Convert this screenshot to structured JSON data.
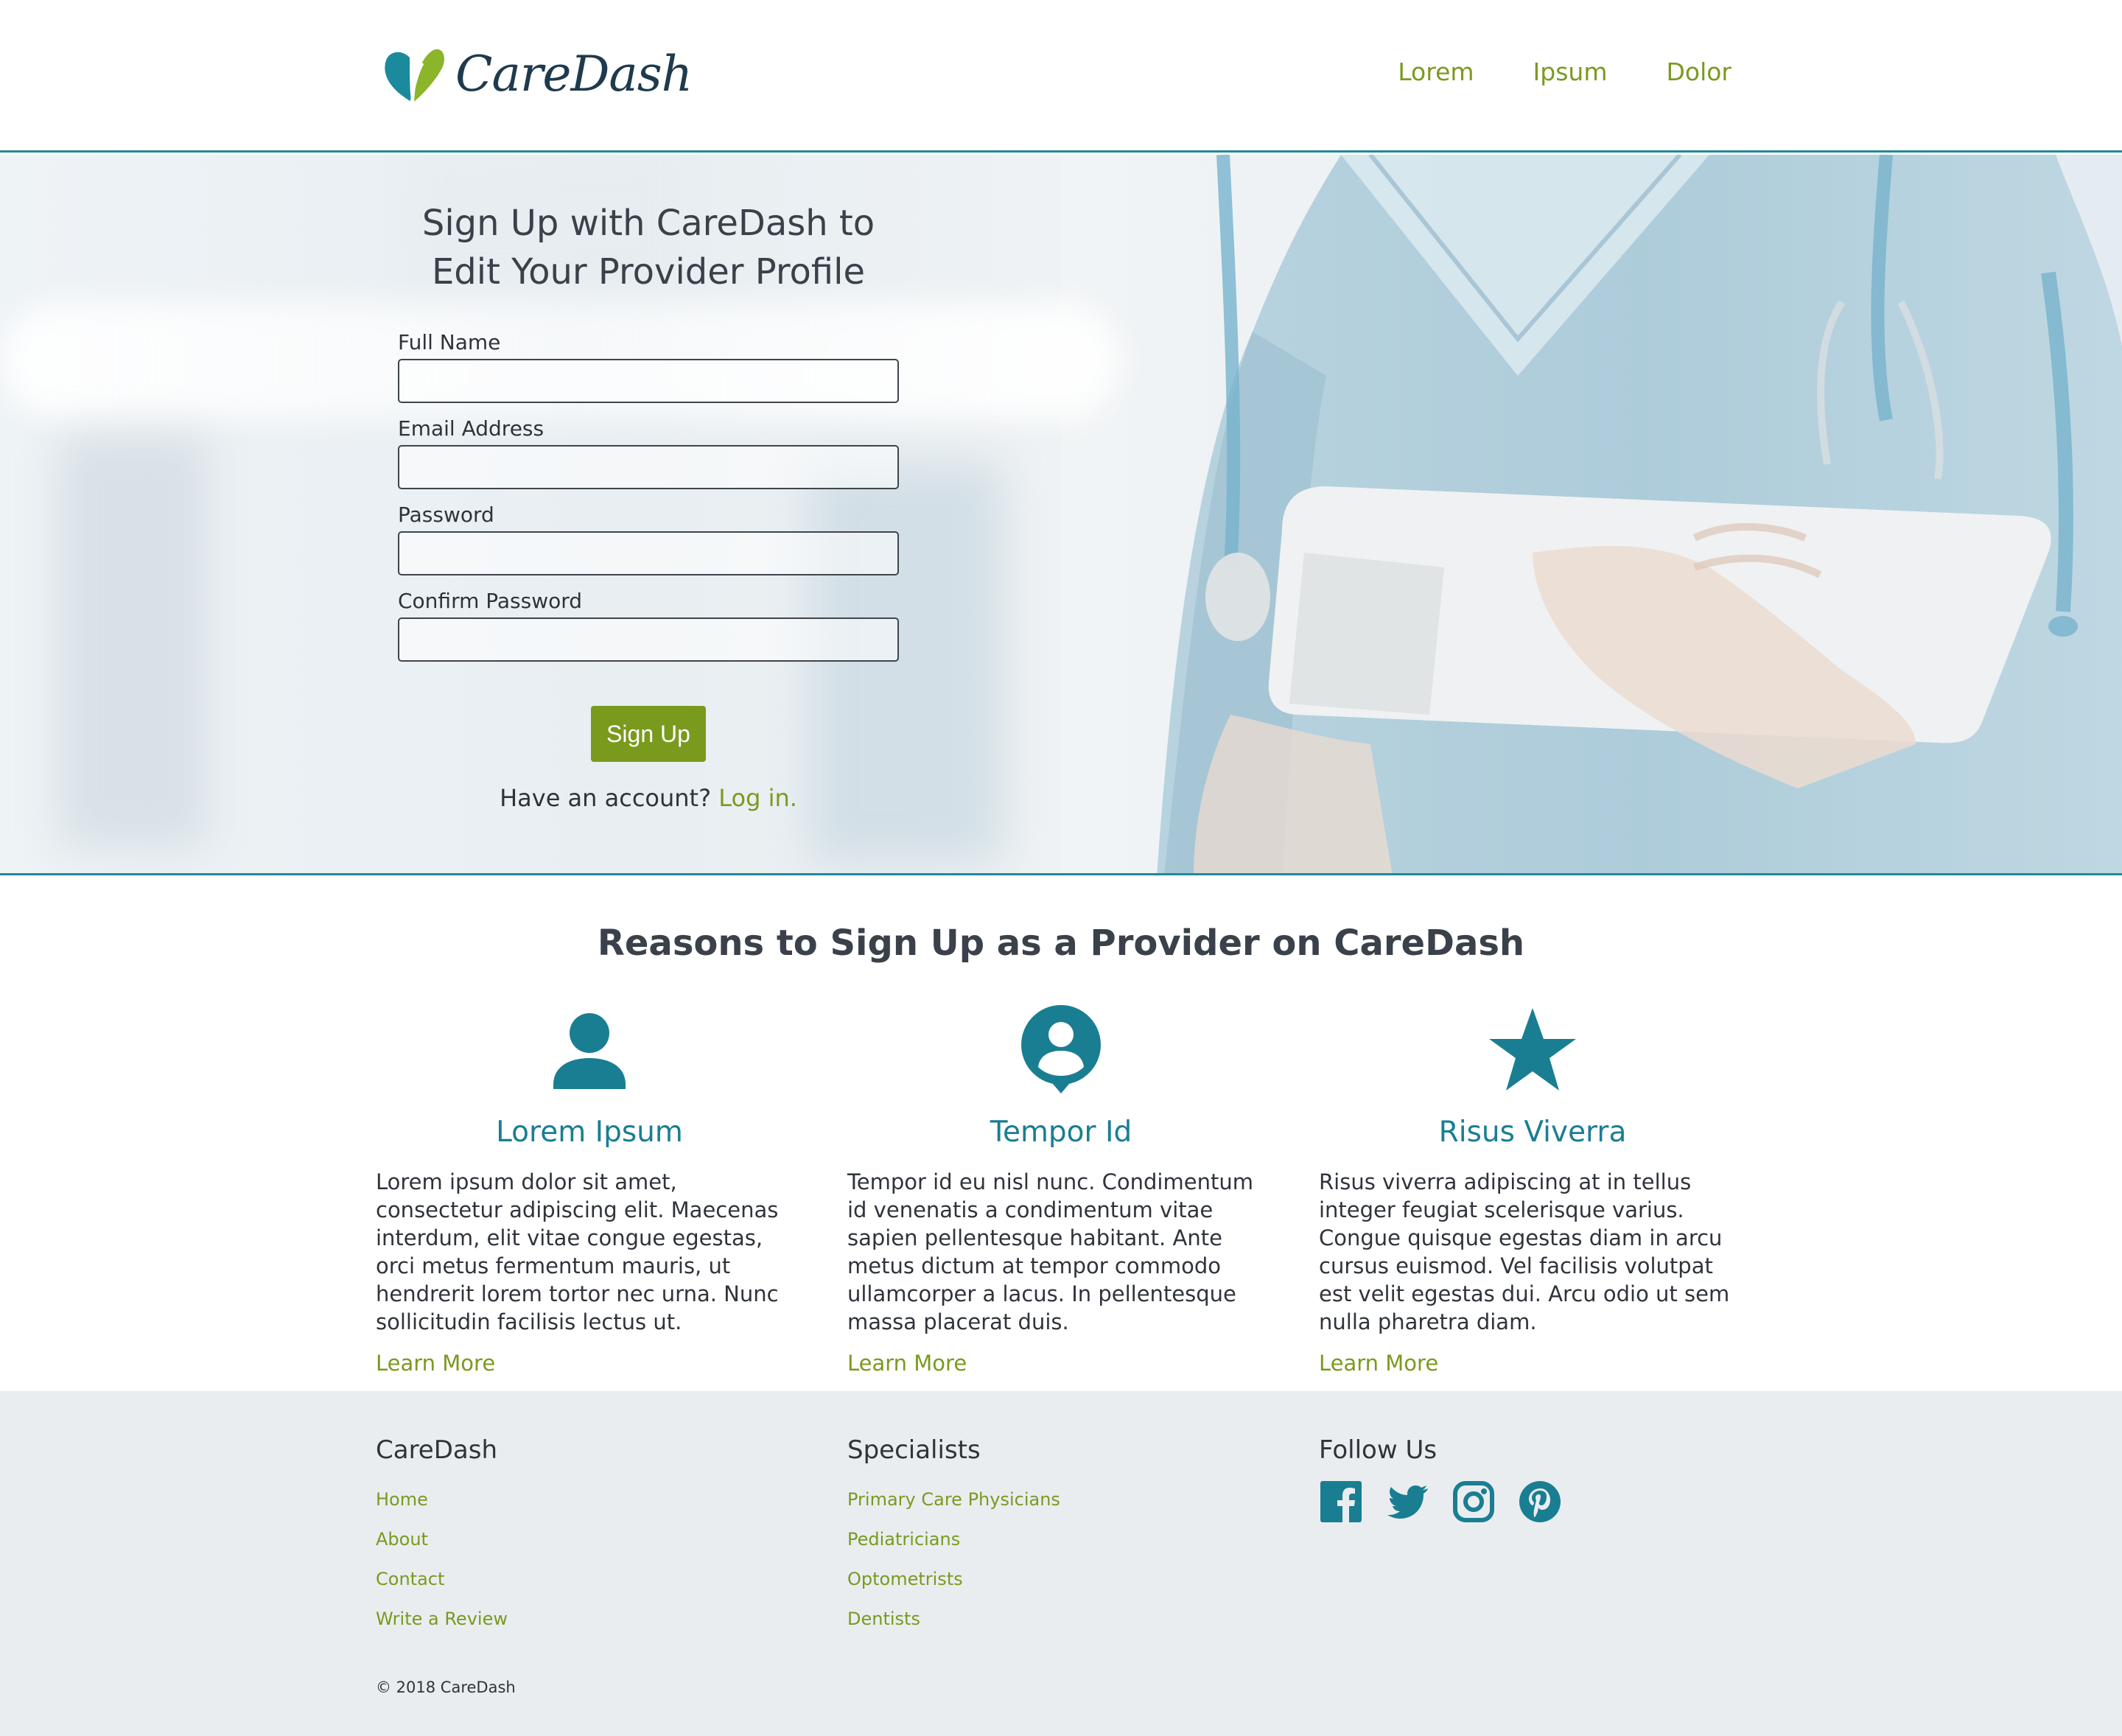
{
  "brand": {
    "name": "CareDash",
    "accent": "#7a9a1e",
    "teal": "#1a7e92"
  },
  "nav": {
    "items": [
      "Lorem",
      "Ipsum",
      "Dolor"
    ]
  },
  "hero": {
    "title": "Sign Up with CareDash to Edit Your Provider Profile",
    "fields": [
      {
        "label": "Full Name",
        "value": ""
      },
      {
        "label": "Email Address",
        "value": ""
      },
      {
        "label": "Password",
        "value": ""
      },
      {
        "label": "Confirm Password",
        "value": ""
      }
    ],
    "button": "Sign Up",
    "account_prompt": "Have an account?",
    "login_link": "Log in."
  },
  "reasons": {
    "title": "Reasons to Sign Up as a Provider on CareDash",
    "columns": [
      {
        "icon": "person-icon",
        "title": "Lorem Ipsum",
        "text": "Lorem ipsum dolor sit amet, consectetur adipiscing elit. Maecenas interdum, elit vitae congue egestas, orci metus fermentum mauris, ut hendrerit lorem tortor nec urna. Nunc sollicitudin facilisis lectus ut.",
        "link": "Learn More"
      },
      {
        "icon": "profile-pin-icon",
        "title": "Tempor Id",
        "text": "Tempor id eu nisl nunc. Condimentum id venenatis a condimentum vitae sapien pellentesque habitant. Ante metus dictum at tempor commodo ullamcorper a lacus. In pellentesque massa placerat duis.",
        "link": "Learn More"
      },
      {
        "icon": "star-icon",
        "title": "Risus Viverra",
        "text": "Risus viverra adipiscing at in tellus integer feugiat scelerisque varius. Congue quisque egestas diam in arcu cursus euismod. Vel facilisis volutpat est velit egestas dui. Arcu odio ut sem nulla pharetra diam.",
        "link": "Learn More"
      }
    ]
  },
  "footer": {
    "col1": {
      "heading": "CareDash",
      "links": [
        "Home",
        "About",
        "Contact",
        "Write a Review"
      ]
    },
    "col2": {
      "heading": "Specialists",
      "links": [
        "Primary Care Physicians",
        "Pediatricians",
        "Optometrists",
        "Dentists"
      ]
    },
    "col3": {
      "heading": "Follow Us",
      "social": [
        "facebook-icon",
        "twitter-icon",
        "instagram-icon",
        "pinterest-icon"
      ]
    },
    "copyright": "© 2018 CareDash"
  }
}
